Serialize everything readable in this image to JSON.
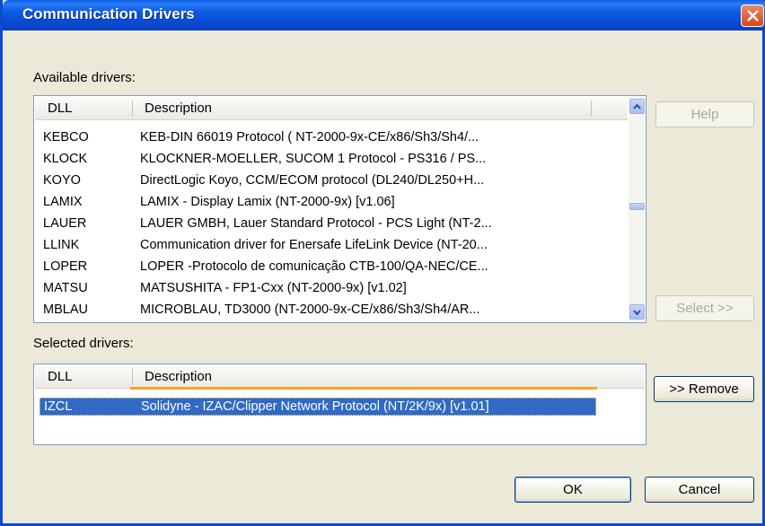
{
  "window": {
    "title": "Communication Drivers"
  },
  "available": {
    "label": "Available drivers:",
    "columns": {
      "dll": "DLL",
      "description": "Description"
    },
    "rows": [
      {
        "dll": "KEBCO",
        "description": "KEB-DIN 66019 Protocol ( NT-2000-9x-CE/x86/Sh3/Sh4/..."
      },
      {
        "dll": "KLOCK",
        "description": "KLOCKNER-MOELLER, SUCOM 1 Protocol - PS316 / PS..."
      },
      {
        "dll": "KOYO",
        "description": "DirectLogic Koyo, CCM/ECOM protocol (DL240/DL250+H..."
      },
      {
        "dll": "LAMIX",
        "description": "LAMIX - Display Lamix (NT-2000-9x) [v1.06]"
      },
      {
        "dll": "LAUER",
        "description": "LAUER GMBH, Lauer Standard Protocol - PCS Light (NT-2..."
      },
      {
        "dll": "LLINK",
        "description": "Communication driver for Enersafe LifeLink Device (NT-20..."
      },
      {
        "dll": "LOPER",
        "description": "LOPER -Protocolo de comunicação CTB-100/QA-NEC/CE..."
      },
      {
        "dll": "MATSU",
        "description": "MATSUSHITA - FP1-Cxx (NT-2000-9x) [v1.02]"
      },
      {
        "dll": "MBLAU",
        "description": "MICROBLAU, TD3000 (NT-2000-9x-CE/x86/Sh3/Sh4/AR..."
      }
    ]
  },
  "selected": {
    "label": "Selected drivers:",
    "columns": {
      "dll": "DLL",
      "description": "Description"
    },
    "rows": [
      {
        "dll": "IZCL",
        "description": "Solidyne - IZAC/Clipper Network Protocol (NT/2K/9x) [v1.01]"
      }
    ]
  },
  "buttons": {
    "help": "Help",
    "select": "Select >>",
    "remove": ">> Remove",
    "ok": "OK",
    "cancel": "Cancel"
  }
}
